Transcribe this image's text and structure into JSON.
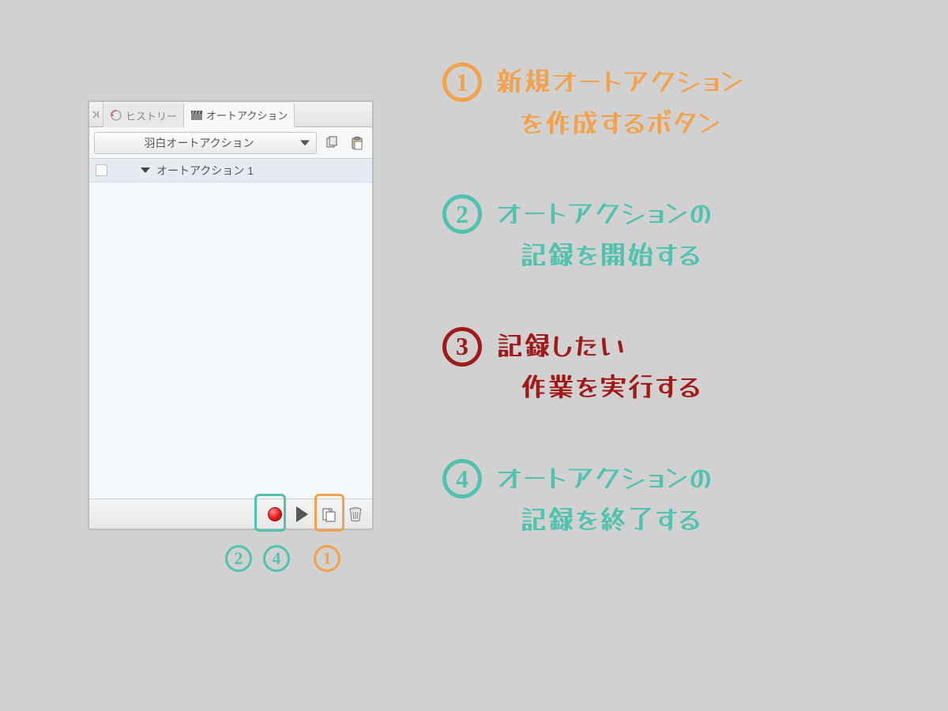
{
  "tabs": {
    "history": "ヒストリー",
    "autoaction": "オートアクション"
  },
  "toolbar": {
    "set_name": "羽白オートアクション"
  },
  "list": {
    "item1": "オートアクション 1"
  },
  "footer_marks": {
    "m2": "2",
    "m4": "4",
    "m1": "1"
  },
  "annotations": {
    "n1": {
      "num": "1",
      "line1": "新規オートアクション",
      "line2": "を作成するボタン"
    },
    "n2": {
      "num": "2",
      "line1": "オートアクションの",
      "line2": "記録を開始する"
    },
    "n3": {
      "num": "3",
      "line1": "記録したい",
      "line2": "作業を実行する"
    },
    "n4": {
      "num": "4",
      "line1": "オートアクションの",
      "line2": "記録を終了する"
    }
  }
}
